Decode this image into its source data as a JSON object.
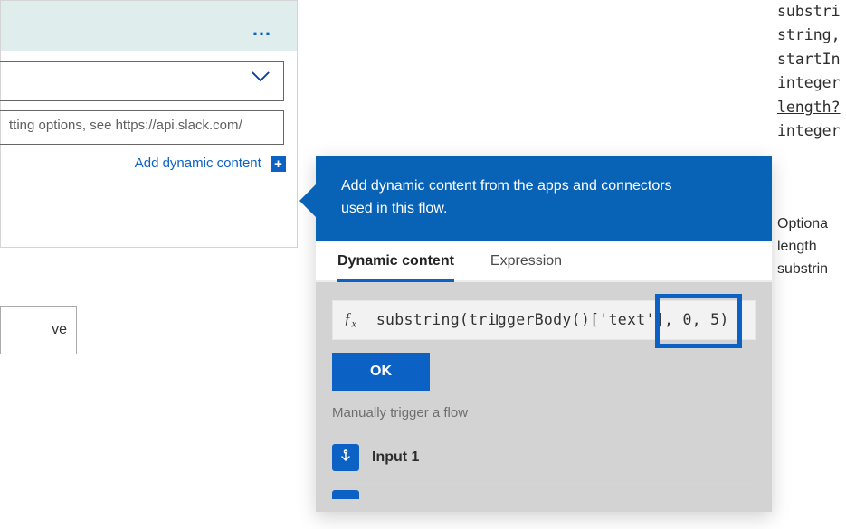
{
  "leftCard": {
    "moreMenuGlyph": "…",
    "inputPlaceholder": "tting options, see https://api.slack.com/",
    "addDynamicContentLabel": "Add dynamic content",
    "plusGlyph": "+"
  },
  "saveButton": {
    "label": "ve"
  },
  "flyout": {
    "headerLine1": "Add dynamic content from the apps and connectors",
    "headerLine2": "used in this flow.",
    "tabs": {
      "dynamic": "Dynamic content",
      "expression": "Expression"
    },
    "activeTab": "dynamic",
    "expression": {
      "fxLabel": "ƒ",
      "fxSub": "x",
      "textA": "substring(tri",
      "cursorGlyph": "I",
      "textB": "ggerBody()['text'], 0, 5)"
    },
    "okButton": "OK",
    "sectionTitle": "Manually trigger a flow",
    "items": [
      {
        "iconGlyph": "👆",
        "label": "Input 1"
      }
    ]
  },
  "rightCode": {
    "lines": [
      "substri",
      "string,",
      "startIn",
      "integer",
      "length?",
      "integer"
    ],
    "underlineIndex": 4
  },
  "rightDesc": {
    "lines": [
      "Optiona",
      "length",
      "substrin"
    ]
  },
  "chart_data": null
}
